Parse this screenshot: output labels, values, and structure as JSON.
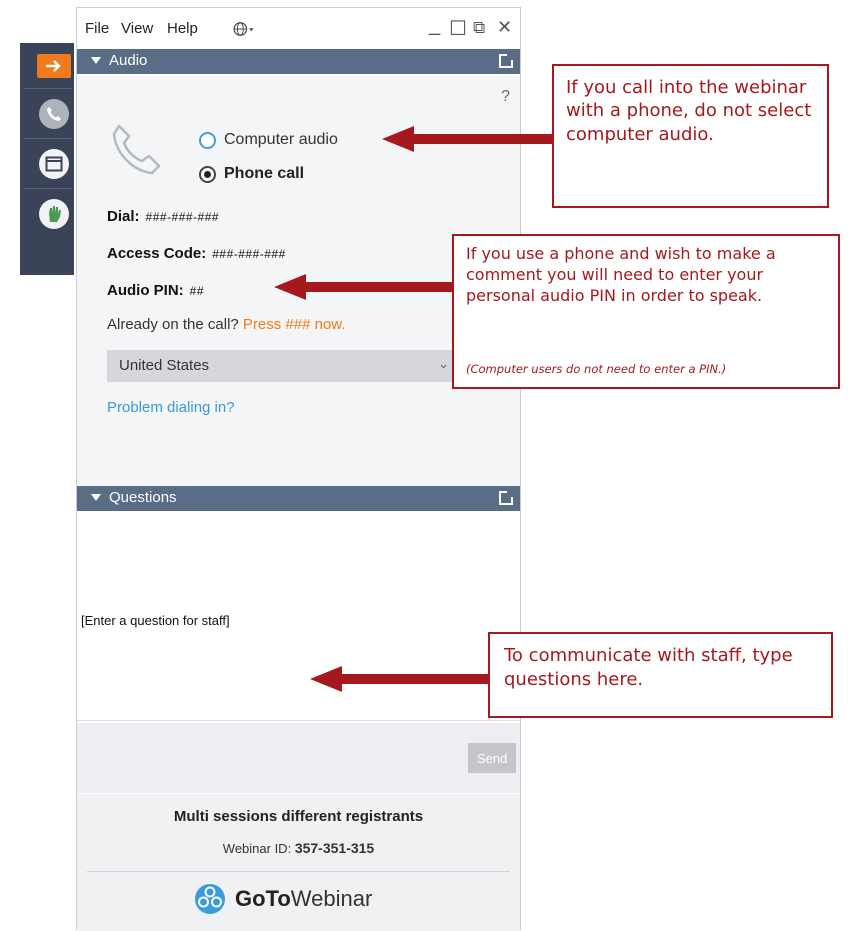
{
  "menu": {
    "file": "File",
    "view": "View",
    "help": "Help"
  },
  "window_controls": {
    "minimize": "_",
    "maximize": "☐",
    "popout": "⧉",
    "close": "✕"
  },
  "audio_panel": {
    "title": "Audio",
    "help": "?",
    "options": [
      {
        "label": "Computer audio",
        "selected": false
      },
      {
        "label": "Phone call",
        "selected": true
      }
    ],
    "dial_label": "Dial:",
    "dial_value": "###-###-###",
    "access_label": "Access Code:",
    "access_value": "###-###-###",
    "pin_label": "Audio PIN:",
    "pin_value": "##",
    "already_text": "Already on the call?",
    "press_text": "Press ###  now.",
    "country": "United States",
    "problem_link": "Problem dialing in?"
  },
  "questions_panel": {
    "title": "Questions",
    "input_placeholder": "[Enter a question for staff]",
    "send_label": "Send"
  },
  "footer": {
    "session_name": "Multi sessions different registrants",
    "webinar_id_label": "Webinar ID:",
    "webinar_id_value": "357-351-315",
    "brand_bold": "GoTo",
    "brand_light": "Webinar"
  },
  "callouts": {
    "computer_audio": "If you call into the webinar with a phone, do not select computer audio.",
    "audio_pin": "If you use a phone and wish to make a comment you will need to enter your personal audio PIN in order to speak.",
    "audio_pin_note": "(Computer users do not need to enter a PIN.)",
    "questions": "To communicate with staff, type questions here."
  },
  "colors": {
    "accent": "#f07a1c",
    "panel_header": "#5a6d87",
    "callout": "#a5191e",
    "link": "#3b9ad9",
    "dock": "#3a4357"
  },
  "icons": [
    "arrow-right-icon",
    "phone-icon",
    "window-icon",
    "hand-raise-icon",
    "globe-icon",
    "popout-icon",
    "gotowebinar-logo-icon"
  ]
}
